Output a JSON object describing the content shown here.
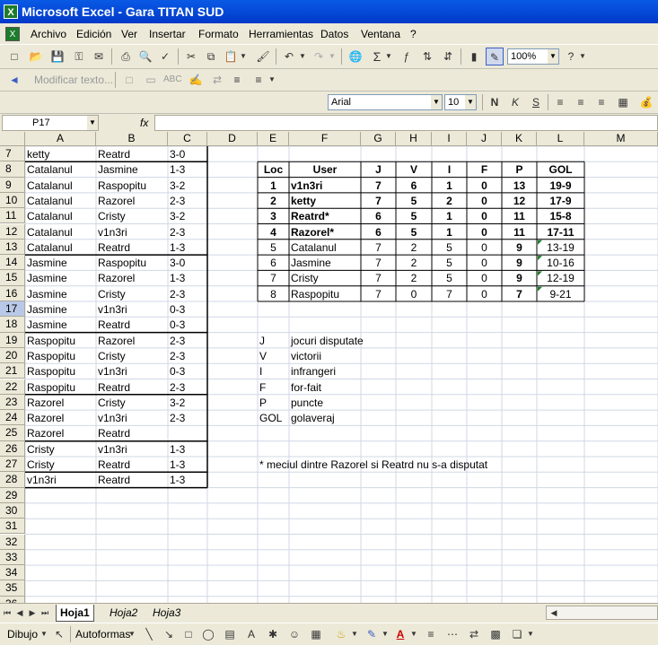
{
  "window": {
    "title": "Microsoft Excel - Gara TITAN SUD",
    "app_icon": "X"
  },
  "menu": {
    "items": [
      "Archivo",
      "Edición",
      "Ver",
      "Insertar",
      "Formato",
      "Herramientas",
      "Datos",
      "Ventana",
      "?"
    ]
  },
  "standard_toolbar": {
    "zoom": "100%"
  },
  "reviewing_toolbar": {
    "modify_text": "Modificar texto..."
  },
  "formatting_toolbar": {
    "font": "Arial",
    "size": "10"
  },
  "formula_bar": {
    "name_box": "P17",
    "fx_label": "fx",
    "value": ""
  },
  "sheet": {
    "columns": [
      "A",
      "B",
      "C",
      "D",
      "E",
      "F",
      "G",
      "H",
      "I",
      "J",
      "K",
      "L",
      "M"
    ],
    "first_row": 7,
    "last_row": 36,
    "selected_row": 17,
    "matches": [
      [
        "ketty",
        "Reatrd",
        "3-0"
      ],
      [
        "Catalanul",
        "Jasmine",
        "1-3"
      ],
      [
        "Catalanul",
        "Raspopitu",
        "3-2"
      ],
      [
        "Catalanul",
        "Razorel",
        "2-3"
      ],
      [
        "Catalanul",
        "Cristy",
        "3-2"
      ],
      [
        "Catalanul",
        "v1n3ri",
        "2-3"
      ],
      [
        "Catalanul",
        "Reatrd",
        "1-3"
      ],
      [
        "Jasmine",
        "Raspopitu",
        "3-0"
      ],
      [
        "Jasmine",
        "Razorel",
        "1-3"
      ],
      [
        "Jasmine",
        "Cristy",
        "2-3"
      ],
      [
        "Jasmine",
        "v1n3ri",
        "0-3"
      ],
      [
        "Jasmine",
        "Reatrd",
        "0-3"
      ],
      [
        "Raspopitu",
        "Razorel",
        "2-3"
      ],
      [
        "Raspopitu",
        "Cristy",
        "2-3"
      ],
      [
        "Raspopitu",
        "v1n3ri",
        "0-3"
      ],
      [
        "Raspopitu",
        "Reatrd",
        "2-3"
      ],
      [
        "Razorel",
        "Cristy",
        "3-2"
      ],
      [
        "Razorel",
        "v1n3ri",
        "2-3"
      ],
      [
        "Razorel",
        "Reatrd",
        ""
      ],
      [
        "Cristy",
        "v1n3ri",
        "1-3"
      ],
      [
        "Cristy",
        "Reatrd",
        "1-3"
      ],
      [
        "v1n3ri",
        "Reatrd",
        "1-3"
      ]
    ],
    "standings": {
      "headers": [
        "Loc",
        "User",
        "J",
        "V",
        "I",
        "F",
        "P",
        "GOL"
      ],
      "rows": [
        [
          "1",
          "v1n3ri",
          "7",
          "6",
          "1",
          "0",
          "13",
          "19-9"
        ],
        [
          "2",
          "ketty",
          "7",
          "5",
          "2",
          "0",
          "12",
          "17-9"
        ],
        [
          "3",
          "Reatrd*",
          "6",
          "5",
          "1",
          "0",
          "11",
          "15-8"
        ],
        [
          "4",
          "Razorel*",
          "6",
          "5",
          "1",
          "0",
          "11",
          "17-11"
        ],
        [
          "5",
          "Catalanul",
          "7",
          "2",
          "5",
          "0",
          "9",
          "13-19"
        ],
        [
          "6",
          "Jasmine",
          "7",
          "2",
          "5",
          "0",
          "9",
          "10-16"
        ],
        [
          "7",
          "Cristy",
          "7",
          "2",
          "5",
          "0",
          "9",
          "12-19"
        ],
        [
          "8",
          "Raspopitu",
          "7",
          "0",
          "7",
          "0",
          "7",
          "9-21"
        ]
      ]
    },
    "legend": [
      [
        "J",
        "jocuri disputate"
      ],
      [
        "V",
        "victorii"
      ],
      [
        "I",
        "infrangeri"
      ],
      [
        "F",
        "for-fait"
      ],
      [
        "P",
        "puncte"
      ],
      [
        "GOL",
        "golaveraj"
      ]
    ],
    "footnote": "* meciul dintre Razorel si Reatrd nu s-a disputat"
  },
  "tabs": [
    "Hoja1",
    "Hoja2",
    "Hoja3"
  ],
  "active_tab": "Hoja1",
  "drawing_toolbar": {
    "draw_label": "Dibujo",
    "autoshapes_label": "Autoformas"
  }
}
